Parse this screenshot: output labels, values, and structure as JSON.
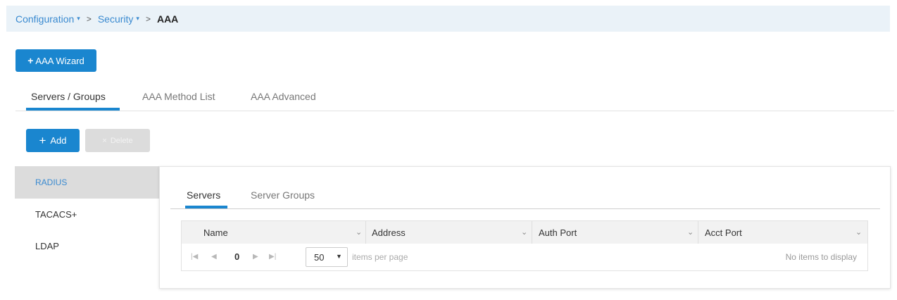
{
  "breadcrumb": {
    "items": [
      "Configuration",
      "Security"
    ],
    "current": "AAA",
    "caret": "▾",
    "separator": ">"
  },
  "wizard_button": {
    "plus": "+",
    "label": "AAA Wizard"
  },
  "main_tabs": {
    "items": [
      "Servers / Groups",
      "AAA Method List",
      "AAA Advanced"
    ],
    "active_index": 0
  },
  "toolbar": {
    "add_plus": "+",
    "add_label": "Add",
    "delete_x": "×",
    "delete_label": "Delete"
  },
  "sidebar": {
    "items": [
      "RADIUS",
      "TACACS+",
      "LDAP"
    ],
    "active_index": 0
  },
  "sub_tabs": {
    "items": [
      "Servers",
      "Server Groups"
    ],
    "active_index": 0
  },
  "grid": {
    "columns": [
      "Name",
      "Address",
      "Auth Port",
      "Acct Port"
    ],
    "sort_caret": "⌄",
    "rows": []
  },
  "pager": {
    "first": "|◀",
    "prev": "◀",
    "page": "0",
    "next": "▶",
    "last": "▶|",
    "page_size": "50",
    "page_size_caret": "▼",
    "items_per_page_label": "items per page",
    "empty_text": "No items to display"
  },
  "colors": {
    "accent": "#1a86cf",
    "breadcrumb_bg": "#eaf2f8",
    "link": "#3a8ad0",
    "sidebar_active_bg": "#dcdcdc"
  }
}
